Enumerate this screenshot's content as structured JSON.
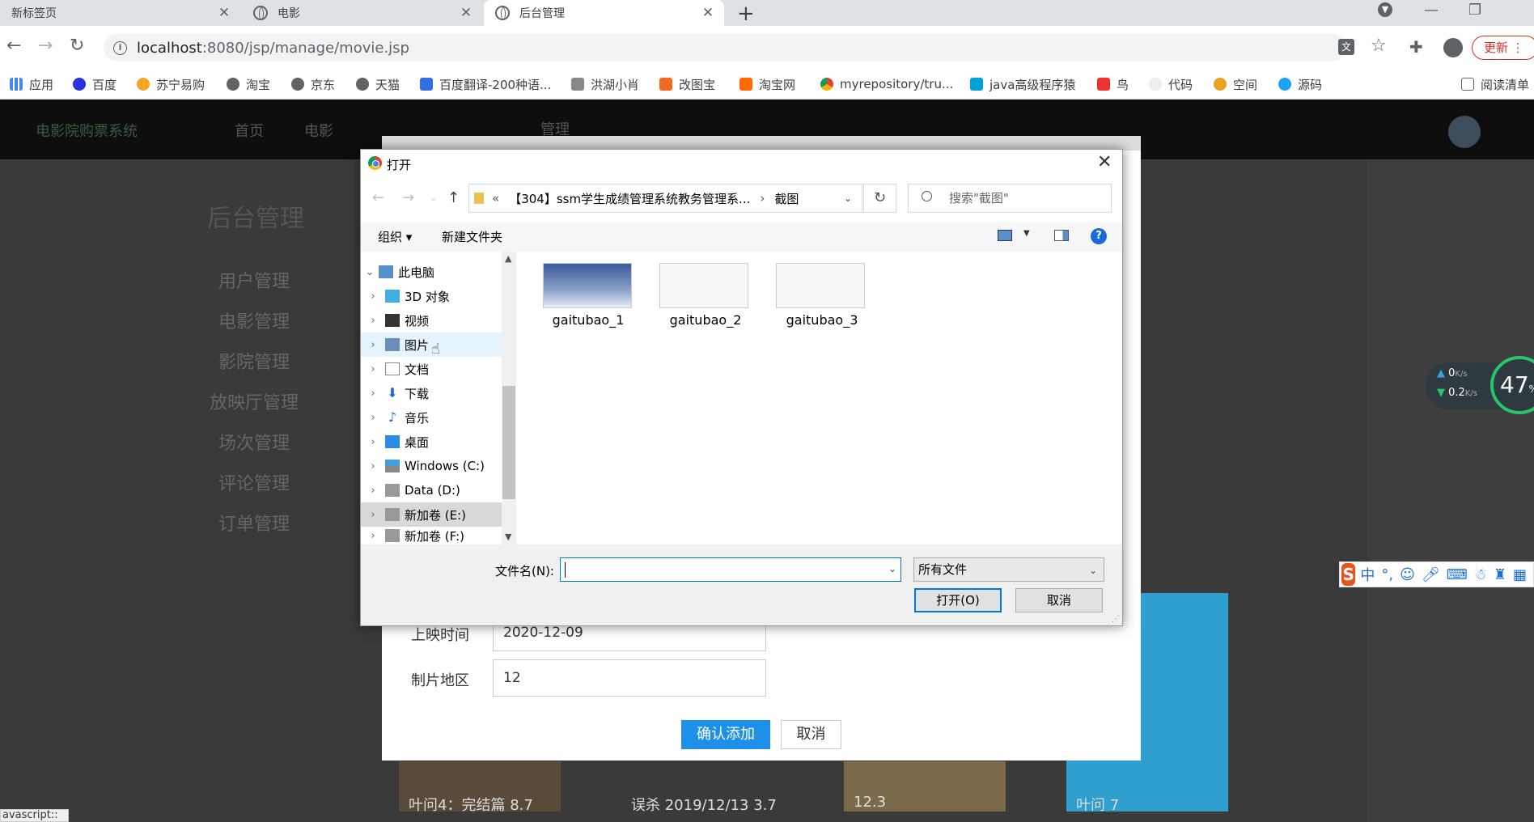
{
  "browser": {
    "tabs": [
      {
        "title": "新标签页"
      },
      {
        "title": "电影"
      },
      {
        "title": "后台管理"
      }
    ],
    "url_host": "localhost",
    "url_rest": ":8080/jsp/manage/movie.jsp",
    "update_label": "更新",
    "bookmarks": [
      "应用",
      "百度",
      "苏宁易购",
      "淘宝",
      "京东",
      "天猫",
      "百度翻译-200种语...",
      "洪湖小肖",
      "改图宝",
      "淘宝网",
      "myrepository/tru...",
      "java高级程序猿",
      "鸟",
      "代码",
      "空间",
      "源码",
      "阅读清单"
    ]
  },
  "site": {
    "brand": "电影院购票系统",
    "nav": [
      "首页",
      "电影",
      "",
      "管理"
    ],
    "sidebar_title": "后台管理",
    "sidebar_items": [
      "用户管理",
      "电影管理",
      "影院管理",
      "放映厅管理",
      "场次管理",
      "评论管理",
      "订单管理"
    ]
  },
  "form": {
    "fields": [
      {
        "label": "上映时间",
        "value": "2020-12-09"
      },
      {
        "label": "制片地区",
        "value": "12"
      }
    ],
    "confirm_label": "确认添加",
    "cancel_label": "取消"
  },
  "posters": [
    {
      "title": "叶问4：完结篇",
      "extra": "8.7"
    },
    {
      "title": "误杀 2019/12/13",
      "extra": "3.7"
    },
    {
      "title": "",
      "extra": "12.3"
    },
    {
      "title": "叶问",
      "extra": "7"
    }
  ],
  "dialog": {
    "title": "打开",
    "path_prefix": "«",
    "path_parent": "【304】ssm学生成绩管理系统教务管理系...",
    "path_current": "截图",
    "search_placeholder": "搜索\"截图\"",
    "organize_label": "组织 ▾",
    "new_folder_label": "新建文件夹",
    "tree": [
      {
        "label": "此电脑",
        "expanded": true
      },
      {
        "label": "3D 对象"
      },
      {
        "label": "视频"
      },
      {
        "label": "图片"
      },
      {
        "label": "文档"
      },
      {
        "label": "下载"
      },
      {
        "label": "音乐"
      },
      {
        "label": "桌面"
      },
      {
        "label": "Windows (C:)"
      },
      {
        "label": "Data (D:)"
      },
      {
        "label": "新加卷 (E:)"
      },
      {
        "label": "新加卷 (F:)"
      }
    ],
    "files": [
      "gaitubao_1",
      "gaitubao_2",
      "gaitubao_3"
    ],
    "filename_label": "文件名(N):",
    "filename_value": "",
    "filetype_value": "所有文件",
    "open_label": "打开(O)",
    "cancel_label": "取消"
  },
  "widgets": {
    "net_up": "0",
    "net_up_unit": "K/s",
    "net_down": "0.2",
    "net_down_unit": "K/s",
    "cpu_percent": "47",
    "status_tip": "avascript::"
  },
  "colors": {
    "accent": "#0078d7",
    "confirm": "#1e90e8",
    "update": "#d93025"
  }
}
